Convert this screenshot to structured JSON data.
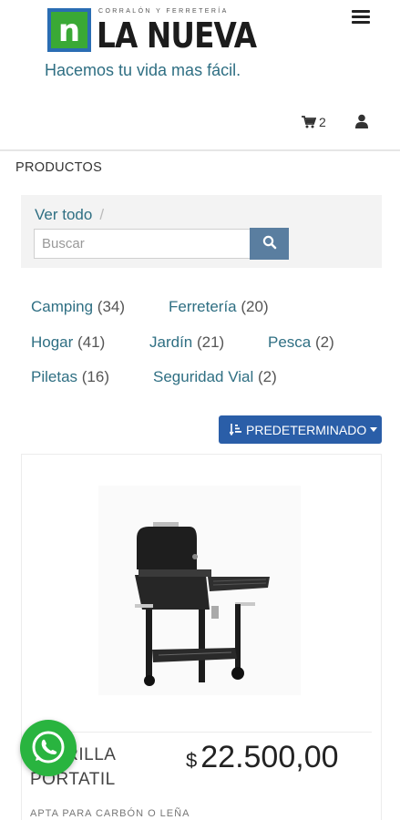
{
  "header": {
    "logo_small": "CORRALÓN Y FERRETERÍA",
    "logo_big": "LA NUEVA",
    "logo_letter": "n",
    "tagline": "Hacemos tu vida mas fácil.",
    "cart_count": "2",
    "icons": [
      "menu-icon",
      "cart-icon",
      "user-icon"
    ]
  },
  "section_title": "PRODUCTOS",
  "filter": {
    "breadcrumb": "Ver todo",
    "breadcrumb_sep": "/",
    "search_placeholder": "Buscar",
    "search_value": ""
  },
  "categories": [
    {
      "name": "Camping",
      "count": "(34)"
    },
    {
      "name": "Ferretería",
      "count": "(20)"
    },
    {
      "name": "Hogar",
      "count": "(41)"
    },
    {
      "name": "Jardín",
      "count": "(21)"
    },
    {
      "name": "Pesca",
      "count": "(2)"
    },
    {
      "name": "Piletas",
      "count": "(16)"
    },
    {
      "name": "Seguridad Vial",
      "count": "(2)"
    }
  ],
  "sort": {
    "label": "PREDETERMINADO"
  },
  "product": {
    "name_line1": "PARRILLA",
    "name_line2": "PORTATIL",
    "currency": "$",
    "price": "22.500,00",
    "description": "APTA PARA CARBÓN O LEÑA"
  },
  "colors": {
    "link": "#2f6f83",
    "primary_button": "#2a5ea8",
    "search_button": "#5a7ea0",
    "whatsapp": "#29b43f",
    "logo_green": "#3aa935",
    "logo_blue": "#2a6db3"
  }
}
